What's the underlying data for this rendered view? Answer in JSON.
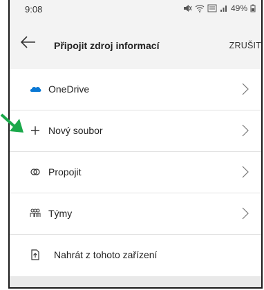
{
  "status": {
    "time": "9:08",
    "battery": "49%"
  },
  "header": {
    "title": "Připojit zdroj informací",
    "cancel": "ZRUŠIT"
  },
  "items": [
    {
      "label": "OneDrive",
      "icon": "onedrive-icon"
    },
    {
      "label": "Nový soubor",
      "icon": "plus-icon"
    },
    {
      "label": "Propojit",
      "icon": "link-icon"
    },
    {
      "label": "Týmy",
      "icon": "teams-icon"
    },
    {
      "label": "Nahrát z tohoto zařízení",
      "icon": "upload-icon"
    }
  ],
  "colors": {
    "onedrive": "#0a78d4",
    "annotation_arrow": "#1aa84a"
  }
}
